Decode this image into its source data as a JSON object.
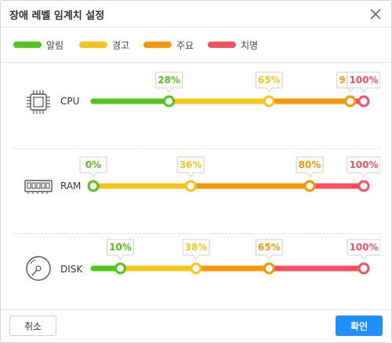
{
  "dialog": {
    "title": "장애 레벨 임계치 설정",
    "close_icon": "close-icon",
    "cancel_label": "취소",
    "confirm_label": "확인"
  },
  "colors": {
    "notice": "#52c41a",
    "warning": "#f5c518",
    "major": "#fa9600",
    "critical": "#f5515f",
    "confirm": "#1e8fff"
  },
  "legend": [
    {
      "label": "알림",
      "color": "#52c41a"
    },
    {
      "label": "경고",
      "color": "#f5c518"
    },
    {
      "label": "주요",
      "color": "#fa9600"
    },
    {
      "label": "치명",
      "color": "#f5515f"
    }
  ],
  "metrics": [
    {
      "name": "CPU",
      "icon": "cpu-icon",
      "thresholds": [
        {
          "label": "28%",
          "value": 28
        },
        {
          "label": "65%",
          "value": 65
        },
        {
          "label": "95%",
          "value": 95
        },
        {
          "label": "100%",
          "value": 100
        }
      ]
    },
    {
      "name": "RAM",
      "icon": "ram-icon",
      "thresholds": [
        {
          "label": "0%",
          "value": 0
        },
        {
          "label": "36%",
          "value": 36
        },
        {
          "label": "80%",
          "value": 80
        },
        {
          "label": "100%",
          "value": 100
        }
      ]
    },
    {
      "name": "DISK",
      "icon": "disk-icon",
      "thresholds": [
        {
          "label": "10%",
          "value": 10
        },
        {
          "label": "38%",
          "value": 38
        },
        {
          "label": "65%",
          "value": 65
        },
        {
          "label": "100%",
          "value": 100
        }
      ]
    }
  ]
}
